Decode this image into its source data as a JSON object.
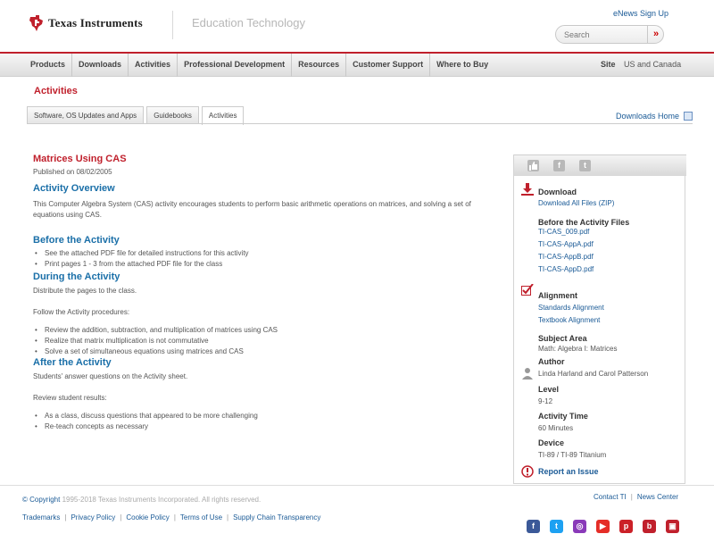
{
  "header": {
    "brand": "Texas Instruments",
    "tagline": "Education Technology",
    "enews_link": "eNews Sign Up",
    "search": {
      "placeholder": "Search",
      "go_icon": "»"
    }
  },
  "nav": {
    "items": [
      "Products",
      "Downloads",
      "Activities",
      "Professional Development",
      "Resources",
      "Customer Support",
      "Where to Buy"
    ],
    "site_label": "Site",
    "site_value": "US and Canada"
  },
  "section_title": "Activities",
  "tabs": [
    "Software, OS Updates and Apps",
    "Guidebooks",
    "Activities"
  ],
  "active_tab": 2,
  "downloads_home": "Downloads Home",
  "activity": {
    "title": "Matrices Using CAS",
    "published": "Published on 08/02/2005",
    "overview_heading": "Activity Overview",
    "overview_text": "This Computer Algebra System (CAS) activity encourages students to perform basic arithmetic operations on matrices, and solving a set of equations using CAS.",
    "before_heading": "Before the Activity",
    "before_items": [
      "See the attached PDF file for detailed instructions for this activity",
      "Print pages 1 - 3 from the attached PDF file for the class"
    ],
    "during_heading": "During the Activity",
    "during_text1": "Distribute the pages to the class.",
    "during_text2": "Follow the Activity procedures:",
    "during_items": [
      "Review the addition, subtraction, and multiplication of matrices using CAS",
      "Realize that matrix multiplication is not commutative",
      "Solve a set of simultaneous equations using matrices and CAS"
    ],
    "after_heading": "After the Activity",
    "after_text1": "Students' answer questions on the Activity sheet.",
    "after_text2": "Review student results:",
    "after_items": [
      "As a class, discuss questions that appeared to be more challenging",
      "Re-teach concepts as necessary"
    ]
  },
  "sidebar": {
    "share_icons": [
      "thumbs-up-icon",
      "facebook-icon",
      "twitter-icon"
    ],
    "download_heading": "Download",
    "download_all": "Download All Files (ZIP)",
    "before_files_heading": "Before the Activity Files",
    "files": [
      "TI-CAS_009.pdf",
      "TI-CAS-AppA.pdf",
      "TI-CAS-AppB.pdf",
      "TI-CAS-AppD.pdf"
    ],
    "alignment_heading": "Alignment",
    "standards_alignment": "Standards Alignment",
    "textbook_alignment": "Textbook Alignment",
    "subject_area_heading": "Subject Area",
    "subject_area": "Math: Algebra I: Matrices",
    "author_heading": "Author",
    "author": "Linda Harland and Carol Patterson",
    "level_heading": "Level",
    "level": "9-12",
    "time_heading": "Activity Time",
    "time": "60 Minutes",
    "device_heading": "Device",
    "device": "TI-89 / TI-89 Titanium",
    "report_issue": "Report an Issue"
  },
  "footer": {
    "copyright_symbol": "© Copyright",
    "copyright_text": " 1995-2018 Texas Instruments Incorporated. All rights reserved.",
    "contact": "Contact TI",
    "news_center": "News Center",
    "legal": [
      "Trademarks",
      "Privacy Policy",
      "Cookie Policy",
      "Terms of Use",
      "Supply Chain Transparency"
    ],
    "social": [
      {
        "icon": "facebook-icon",
        "glyph": "f",
        "color": "#3b5998"
      },
      {
        "icon": "twitter-icon",
        "glyph": "t",
        "color": "#1da1f2"
      },
      {
        "icon": "instagram-icon",
        "glyph": "◎",
        "color": "#8a3ab9"
      },
      {
        "icon": "youtube-icon",
        "glyph": "▶",
        "color": "#e52d27"
      },
      {
        "icon": "pinterest-icon",
        "glyph": "p",
        "color": "#cb2027"
      },
      {
        "icon": "blog-icon",
        "glyph": "b",
        "color": "#c0202c"
      },
      {
        "icon": "tube-icon",
        "glyph": "▣",
        "color": "#c0202c"
      }
    ]
  },
  "colors": {
    "brand_red": "#c0202c",
    "link_blue": "#1a5a96",
    "heading_blue": "#1a6fa8"
  }
}
